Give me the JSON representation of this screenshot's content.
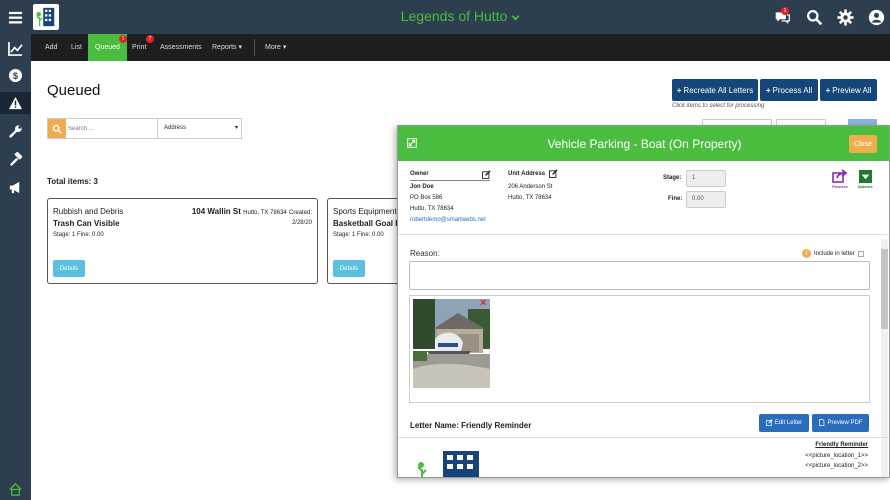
{
  "app": {
    "title": "Legends of Hutto"
  },
  "topbar": {
    "notification_count": "1"
  },
  "nav": {
    "items": [
      {
        "label": "Add"
      },
      {
        "label": "List"
      },
      {
        "label": "Queued",
        "badge": "1"
      },
      {
        "label": "Print",
        "badge": "7"
      },
      {
        "label": "Assessments"
      },
      {
        "label": "Reports ▾"
      },
      {
        "label": "More ▾"
      }
    ]
  },
  "page": {
    "title": "Queued",
    "buttons": {
      "recreate": "Recreate All Letters",
      "process": "Process All",
      "preview": "Preview All"
    },
    "hint": "Click items to select for processing",
    "search_placeholder": "Search ...",
    "search_field": "Address",
    "total_label": "Total items: 3"
  },
  "cards": [
    {
      "category": "Rubbish and Debris",
      "title": "Trash Can Visible",
      "meta": "Stage: 1 Fine: 0.00",
      "address": "104 Wallin St",
      "city": "Hutto, TX 78634",
      "created_label": "Created:",
      "date": "2/28/20",
      "details": "Details"
    },
    {
      "category": "Sports Equipment",
      "title": "Basketball Goal I",
      "meta": "Stage: 1 Fine: 0.00",
      "details": "Details"
    }
  ],
  "modal": {
    "title": "Vehicle Parking - Boat (On Property)",
    "close": "Close",
    "owner_label": "Owner",
    "owner_name": "Jon Doe",
    "owner_addr1": "PO Box 586",
    "owner_addr2": "Hutto, TX 78634",
    "owner_email": "robertdemo@smartwebs.net",
    "unit_label": "Unit Address",
    "unit_addr1": "206 Anderson St",
    "unit_addr2": "Hutto, TX 78634",
    "stage_label": "Stage:",
    "stage_value": "1",
    "fine_label": "Fine:",
    "fine_value": "0.00",
    "process_label": "Process",
    "options_label": "Options",
    "reason_label": "Reason:",
    "include_label": "Include in letter",
    "letter_name": "Letter Name: Friendly Reminder",
    "edit_letter": "Edit Letter",
    "preview_pdf": "Preview PDF",
    "preview_title": "Friendly Reminder",
    "preview_line1": "<<picture_location_1>>",
    "preview_line2": "<<picture_location_2>>"
  },
  "colors": {
    "rail": "#2d3e4f",
    "accent_green": "#4bbd3e",
    "navy_button": "#16457a",
    "warning": "#f0ad4e",
    "info": "#5bc0de"
  }
}
